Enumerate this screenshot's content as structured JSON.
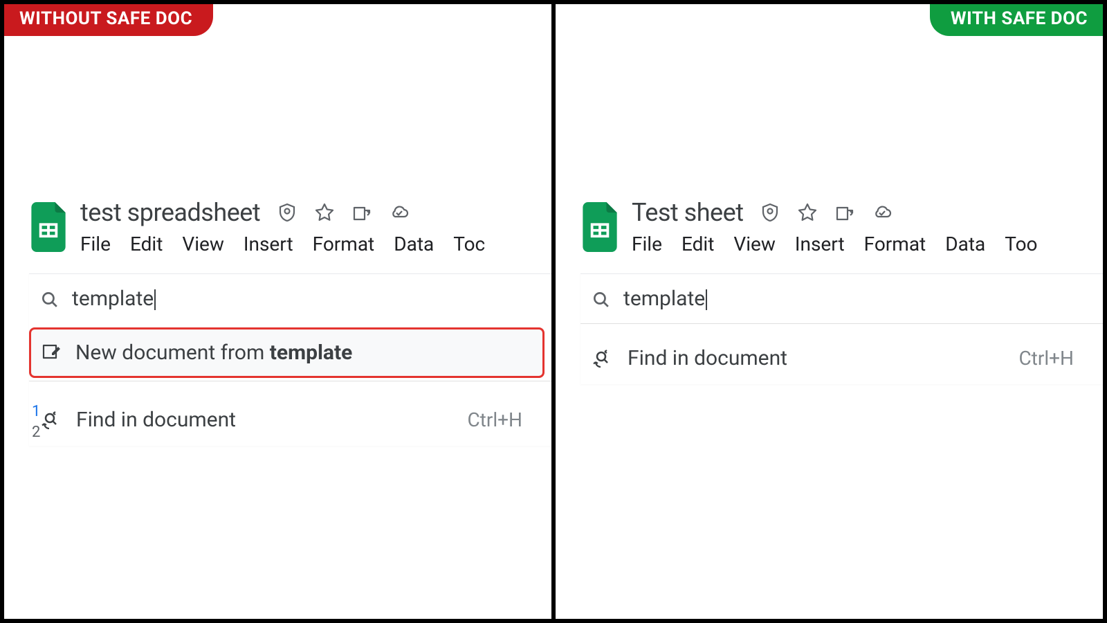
{
  "left": {
    "badge": "WITHOUT SAFE DOC",
    "doc_title": "test spreadsheet",
    "menus": [
      "File",
      "Edit",
      "View",
      "Insert",
      "Format",
      "Data",
      "Toc"
    ],
    "search_text": "template",
    "result_template_prefix": "New document from ",
    "result_template_bold": "template",
    "result_find": "Find in document",
    "shortcut": "Ctrl+H"
  },
  "right": {
    "badge": "WITH SAFE DOC",
    "doc_title": "Test sheet",
    "menus": [
      "File",
      "Edit",
      "View",
      "Insert",
      "Format",
      "Data",
      "Too"
    ],
    "search_text": "template",
    "result_find": "Find in document",
    "shortcut": "Ctrl+H"
  }
}
